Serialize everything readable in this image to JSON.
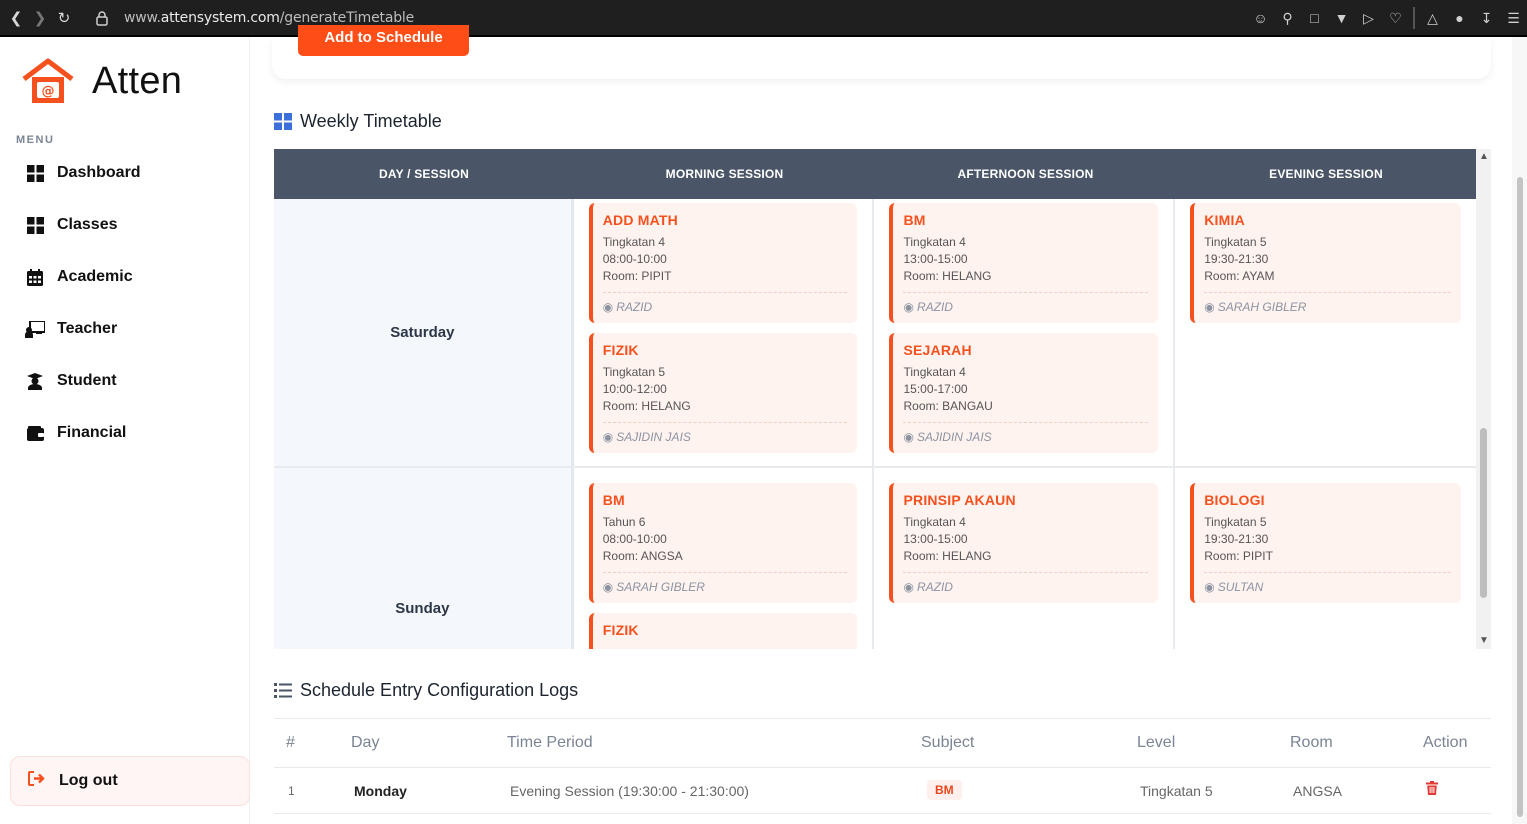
{
  "browser": {
    "url_prefix": "www.",
    "url_host": "attensystem.com",
    "url_path": "/generateTimetable"
  },
  "sidebar": {
    "brand": "Atten",
    "menu_label": "MENU",
    "items": [
      {
        "label": "Dashboard",
        "icon": "grid-icon"
      },
      {
        "label": "Classes",
        "icon": "grid-icon"
      },
      {
        "label": "Academic",
        "icon": "calendar-icon"
      },
      {
        "label": "Teacher",
        "icon": "chalkboard-teacher-icon"
      },
      {
        "label": "Student",
        "icon": "graduate-icon"
      },
      {
        "label": "Financial",
        "icon": "wallet-icon"
      }
    ],
    "logout_label": "Log out"
  },
  "top_card": {
    "add_button": "Add to Schedule"
  },
  "timetable": {
    "title": "Weekly Timetable",
    "headers": [
      "DAY / SESSION",
      "MORNING SESSION",
      "AFTERNOON SESSION",
      "EVENING SESSION"
    ],
    "rows": [
      {
        "day": "Saturday",
        "morning": [
          {
            "subject": "ADD MATH",
            "level": "Tingkatan 4",
            "time": "08:00-10:00",
            "room": "Room: PIPIT",
            "teacher": "RAZID"
          },
          {
            "subject": "FIZIK",
            "level": "Tingkatan 5",
            "time": "10:00-12:00",
            "room": "Room: HELANG",
            "teacher": "SAJIDIN JAIS"
          }
        ],
        "afternoon": [
          {
            "subject": "BM",
            "level": "Tingkatan 4",
            "time": "13:00-15:00",
            "room": "Room: HELANG",
            "teacher": "RAZID"
          },
          {
            "subject": "SEJARAH",
            "level": "Tingkatan 4",
            "time": "15:00-17:00",
            "room": "Room: BANGAU",
            "teacher": "SAJIDIN JAIS"
          }
        ],
        "evening": [
          {
            "subject": "KIMIA",
            "level": "Tingkatan 5",
            "time": "19:30-21:30",
            "room": "Room: AYAM",
            "teacher": "SARAH GIBLER"
          }
        ]
      },
      {
        "day": "Sunday",
        "morning": [
          {
            "subject": "BM",
            "level": "Tahun 6",
            "time": "08:00-10:00",
            "room": "Room: ANGSA",
            "teacher": "SARAH GIBLER"
          },
          {
            "subject": "FIZIK",
            "level": "",
            "time": "",
            "room": "",
            "teacher": ""
          }
        ],
        "afternoon": [
          {
            "subject": "PRINSIP AKAUN",
            "level": "Tingkatan 4",
            "time": "13:00-15:00",
            "room": "Room: HELANG",
            "teacher": "RAZID"
          }
        ],
        "evening": [
          {
            "subject": "BIOLOGI",
            "level": "Tingkatan 5",
            "time": "19:30-21:30",
            "room": "Room: PIPIT",
            "teacher": "SULTAN"
          }
        ]
      }
    ]
  },
  "logs": {
    "title": "Schedule Entry Configuration Logs",
    "headers": {
      "num": "#",
      "day": "Day",
      "time": "Time Period",
      "subject": "Subject",
      "level": "Level",
      "room": "Room",
      "action": "Action"
    },
    "rows": [
      {
        "num": "1",
        "day": "Monday",
        "time": "Evening Session (19:30:00 - 21:30:00)",
        "subject": "BM",
        "level": "Tingkatan 5",
        "room": "ANGSA"
      }
    ]
  },
  "colors": {
    "accent": "#f4511e",
    "header_bg": "#4a5568",
    "entry_bg": "#fff3f0"
  }
}
